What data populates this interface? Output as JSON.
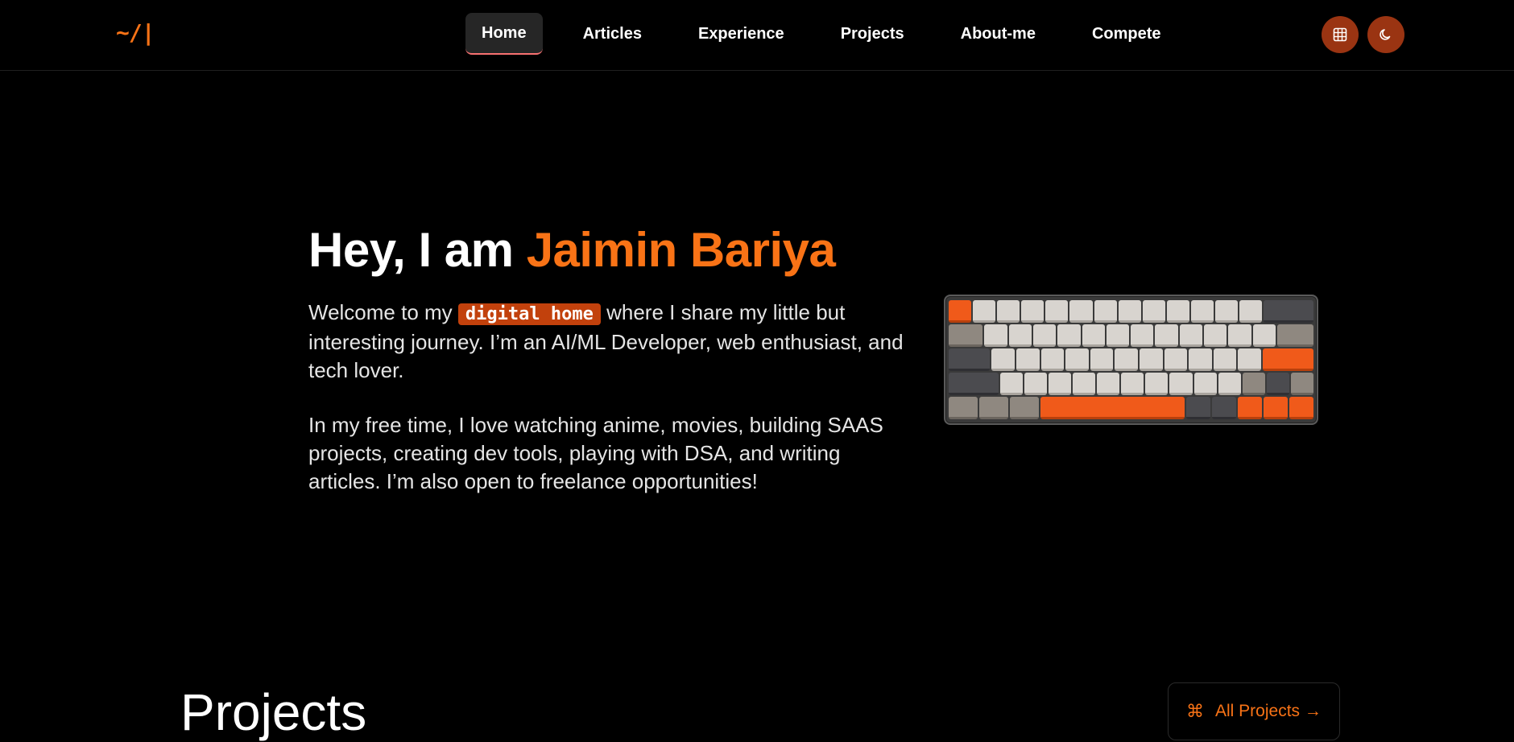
{
  "logo": "~/|",
  "nav": {
    "items": [
      "Home",
      "Articles",
      "Experience",
      "Projects",
      "About-me",
      "Compete"
    ]
  },
  "icons": {
    "layout_button": "grid-icon",
    "theme_button": "moon-icon"
  },
  "hero": {
    "greeting": "Hey, I am",
    "name": "Jaimin Bariya",
    "p1_before": "Welcome to my",
    "p1_highlight": "digital home",
    "p1_after": "where I share my little but interesting journey. I’m an AI/ML Developer, web enthusiast, and tech lover.",
    "p2": "In my free time, I love watching anime, movies, building SAAS projects, creating dev tools, playing with DSA, and writing articles. I’m also open to freelance opportunities!"
  },
  "projects": {
    "title": "Projects",
    "all_label": "All Projects →",
    "all_icon": "command-icon"
  },
  "colors": {
    "accent": "#f97316",
    "button_bg": "#9a3412",
    "pill_bg": "#c2410c"
  }
}
